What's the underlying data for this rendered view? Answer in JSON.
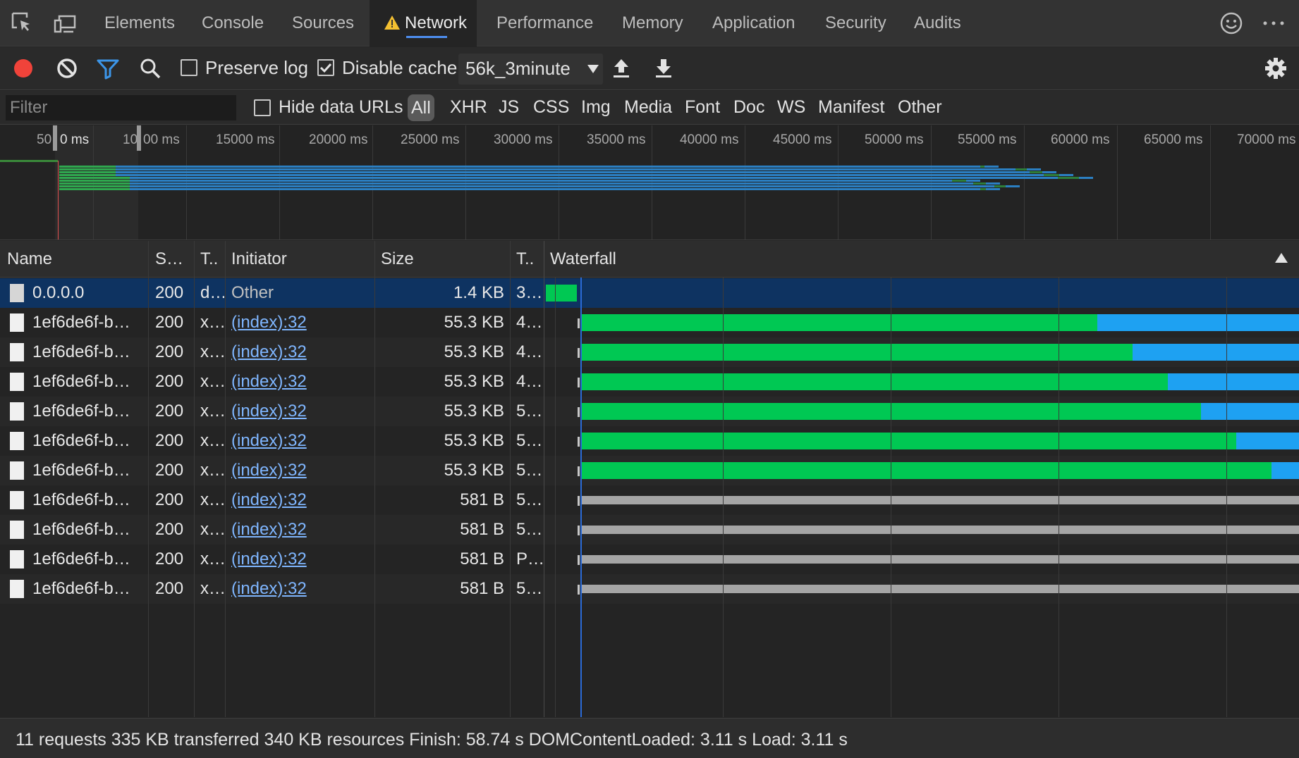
{
  "tabs": [
    {
      "label": "Elements"
    },
    {
      "label": "Console"
    },
    {
      "label": "Sources"
    },
    {
      "label": "Network"
    },
    {
      "label": "Performance"
    },
    {
      "label": "Memory"
    },
    {
      "label": "Application"
    },
    {
      "label": "Security"
    },
    {
      "label": "Audits"
    }
  ],
  "active_tab": "Network",
  "toolbar": {
    "preserve_log_label": "Preserve log",
    "preserve_log_checked": false,
    "disable_cache_label": "Disable cache",
    "disable_cache_checked": true,
    "throttling_value": "56k_3minute"
  },
  "filter": {
    "placeholder": "Filter",
    "hide_data_urls_label": "Hide data URLs",
    "types": [
      "All",
      "XHR",
      "JS",
      "CSS",
      "Img",
      "Media",
      "Font",
      "Doc",
      "WS",
      "Manifest",
      "Other"
    ],
    "active_type": "All"
  },
  "overview": {
    "labels": [
      "50",
      "0 ms",
      "10",
      "00 ms",
      "15000 ms",
      "20000 ms",
      "25000 ms",
      "30000 ms",
      "35000 ms",
      "40000 ms",
      "45000 ms",
      "50000 ms",
      "55000 ms",
      "60000 ms",
      "65000 ms",
      "70000 ms"
    ]
  },
  "columns": {
    "name": "Name",
    "status": "S…",
    "type": "T..",
    "initiator": "Initiator",
    "size": "Size",
    "time": "T..",
    "waterfall": "Waterfall"
  },
  "rows": [
    {
      "name": "0.0.0.0",
      "status": "200",
      "type": "d…",
      "initiator": "Other",
      "initiator_link": false,
      "size": "1.4 KB",
      "time": "3…",
      "selected": true
    },
    {
      "name": "1ef6de6f-b…",
      "status": "200",
      "type": "x…",
      "initiator": "(index):32",
      "initiator_link": true,
      "size": "55.3 KB",
      "time": "4…"
    },
    {
      "name": "1ef6de6f-b…",
      "status": "200",
      "type": "x…",
      "initiator": "(index):32",
      "initiator_link": true,
      "size": "55.3 KB",
      "time": "4…"
    },
    {
      "name": "1ef6de6f-b…",
      "status": "200",
      "type": "x…",
      "initiator": "(index):32",
      "initiator_link": true,
      "size": "55.3 KB",
      "time": "4…"
    },
    {
      "name": "1ef6de6f-b…",
      "status": "200",
      "type": "x…",
      "initiator": "(index):32",
      "initiator_link": true,
      "size": "55.3 KB",
      "time": "5…"
    },
    {
      "name": "1ef6de6f-b…",
      "status": "200",
      "type": "x…",
      "initiator": "(index):32",
      "initiator_link": true,
      "size": "55.3 KB",
      "time": "5…"
    },
    {
      "name": "1ef6de6f-b…",
      "status": "200",
      "type": "x…",
      "initiator": "(index):32",
      "initiator_link": true,
      "size": "55.3 KB",
      "time": "5…"
    },
    {
      "name": "1ef6de6f-b…",
      "status": "200",
      "type": "x…",
      "initiator": "(index):32",
      "initiator_link": true,
      "size": "581 B",
      "time": "5…"
    },
    {
      "name": "1ef6de6f-b…",
      "status": "200",
      "type": "x…",
      "initiator": "(index):32",
      "initiator_link": true,
      "size": "581 B",
      "time": "5…"
    },
    {
      "name": "1ef6de6f-b…",
      "status": "200",
      "type": "x…",
      "initiator": "(index):32",
      "initiator_link": true,
      "size": "581 B",
      "time": "P…"
    },
    {
      "name": "1ef6de6f-b…",
      "status": "200",
      "type": "x…",
      "initiator": "(index):32",
      "initiator_link": true,
      "size": "581 B",
      "time": "5…"
    }
  ],
  "colors": {
    "waiting": "#00c853",
    "download": "#1ea1f2",
    "pending": "#a5a5a5",
    "selection": "#0e3361",
    "record": "#f0433a",
    "filter_active": "#3c95e8"
  },
  "status": {
    "text": "11 requests  335 KB transferred  340 KB resources  Finish: 58.74 s  DOMContentLoaded: 3.11 s  Load: 3.11 s"
  }
}
